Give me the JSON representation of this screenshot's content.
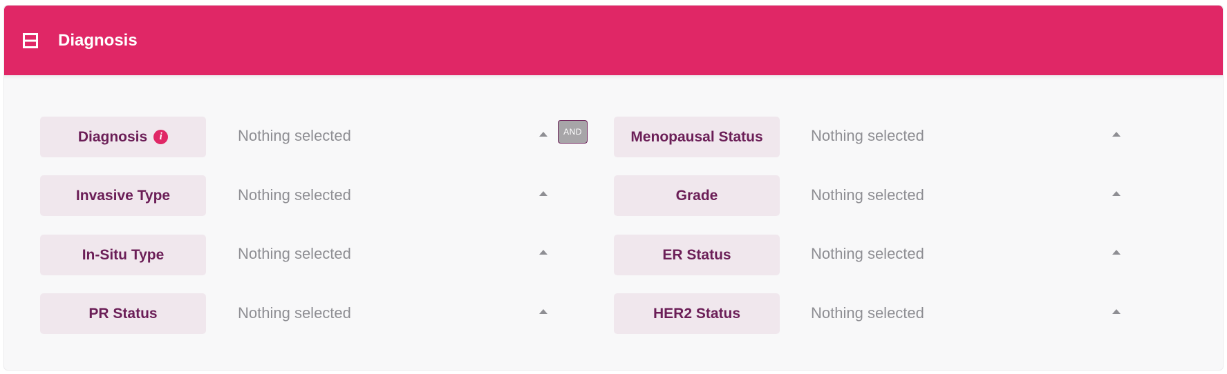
{
  "panel": {
    "title": "Diagnosis",
    "collapse_icon": "collapse-icon",
    "accent_color": "#e02766"
  },
  "operator": {
    "label": "AND"
  },
  "fields": {
    "diagnosis": {
      "label": "Diagnosis",
      "value": "Nothing selected",
      "info_icon": "info-icon"
    },
    "menopausal_status": {
      "label": "Menopausal Status",
      "value": "Nothing selected"
    },
    "invasive_type": {
      "label": "Invasive Type",
      "value": "Nothing selected"
    },
    "grade": {
      "label": "Grade",
      "value": "Nothing selected"
    },
    "in_situ_type": {
      "label": "In-Situ Type",
      "value": "Nothing selected"
    },
    "er_status": {
      "label": "ER Status",
      "value": "Nothing selected"
    },
    "pr_status": {
      "label": "PR Status",
      "value": "Nothing selected"
    },
    "her2_status": {
      "label": "HER2 Status",
      "value": "Nothing selected"
    }
  }
}
